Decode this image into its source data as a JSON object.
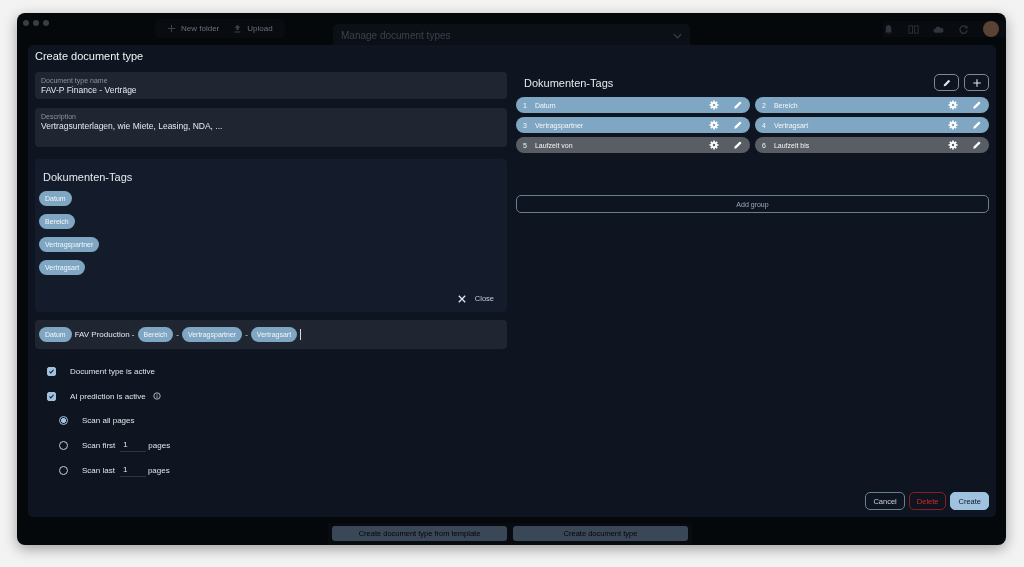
{
  "background": {
    "toolbar": [
      {
        "kind": "plus",
        "label": "New folder"
      },
      {
        "kind": "upload",
        "label": "Upload"
      }
    ],
    "panel_title": "Manage document types",
    "top_icons": [
      {
        "kind": "bell"
      },
      {
        "kind": "columns"
      },
      {
        "kind": "cloud"
      },
      {
        "kind": "refresh"
      }
    ],
    "bottom_buttons": [
      "Create document type from template",
      "Create document type"
    ]
  },
  "dialog": {
    "title": "Create document type",
    "name_field": {
      "label": "Document type name",
      "value": "FAV-P Finance - Verträge"
    },
    "description_field": {
      "label": "Description",
      "value": "Vertragsunterlagen, wie Miete, Leasing, NDA, ..."
    },
    "tag_picker": {
      "title": "Dokumenten-Tags",
      "tags": [
        "Datum",
        "Bereich",
        "Vertragspartner",
        "Vertragsart"
      ],
      "close": "Close"
    },
    "pattern": [
      {
        "kind": "tag",
        "text": "Datum"
      },
      {
        "kind": "text",
        "text": "FAV Production -"
      },
      {
        "kind": "tag",
        "text": "Bereich"
      },
      {
        "kind": "text",
        "text": "-"
      },
      {
        "kind": "tag",
        "text": "Vertragspartner"
      },
      {
        "kind": "text",
        "text": "-"
      },
      {
        "kind": "tag",
        "text": "Vertragsart"
      }
    ],
    "checkboxes": [
      {
        "label": "Document type is active",
        "checked": true,
        "info": false
      },
      {
        "label": "AI prediction is active",
        "checked": true,
        "info": true
      }
    ],
    "scan_options": [
      {
        "label": "Scan all pages",
        "selected": true
      },
      {
        "label": "Scan first",
        "value": "1",
        "suffix": "pages",
        "selected": false
      },
      {
        "label": "Scan last",
        "value": "1",
        "suffix": "pages",
        "selected": false
      }
    ],
    "tag_list": {
      "title": "Dokumenten-Tags",
      "items": [
        {
          "number": "1",
          "name": "Datum",
          "in_use": true
        },
        {
          "number": "2",
          "name": "Bereich",
          "in_use": true
        },
        {
          "number": "3",
          "name": "Vertragspartner",
          "in_use": true
        },
        {
          "number": "4",
          "name": "Vertragsart",
          "in_use": true
        },
        {
          "number": "5",
          "name": "Laufzeit von",
          "in_use": false
        },
        {
          "number": "6",
          "name": "Laufzeit bis",
          "in_use": false
        }
      ],
      "add_group": "Add group"
    },
    "buttons": [
      {
        "kind": "cancel",
        "label": "Cancel"
      },
      {
        "kind": "delete",
        "label": "Delete"
      },
      {
        "kind": "create",
        "label": "Create"
      }
    ]
  }
}
